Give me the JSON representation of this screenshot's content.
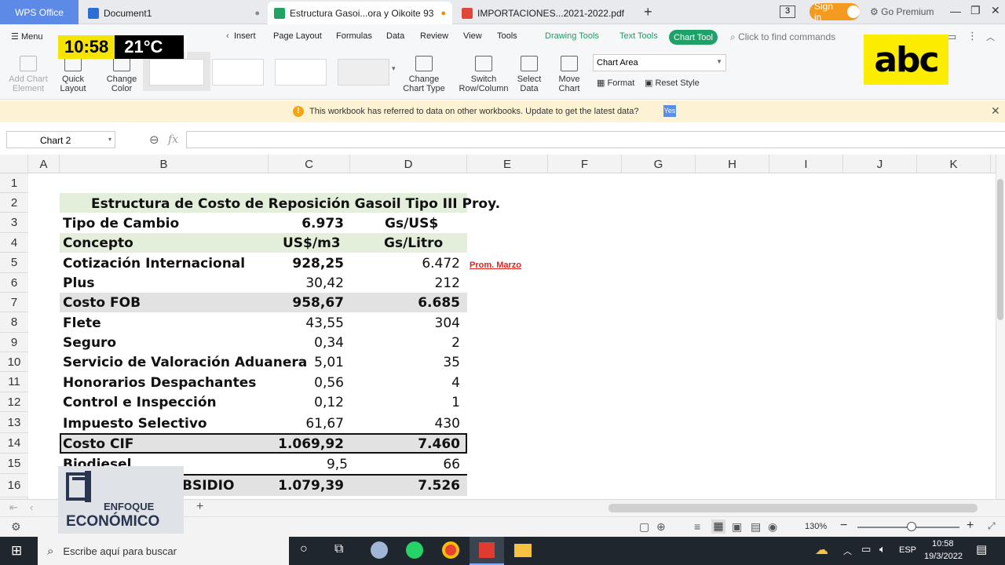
{
  "titlebar": {
    "app_tab": "WPS Office",
    "tabs": [
      {
        "label": "Document1",
        "icon_color": "#2b6fd6"
      },
      {
        "label": "Estructura Gasoi...ora y Oikoite 93",
        "icon_color": "#1ea362"
      },
      {
        "label": "IMPORTACIONES...2021-2022.pdf",
        "icon_color": "#e0463a"
      }
    ],
    "new_tab": "+",
    "page_badge": "3",
    "sign_in": "Sign in",
    "go_premium": "Go Premium"
  },
  "menu": {
    "hamburger": "Menu",
    "items": [
      "Insert",
      "Page Layout",
      "Formulas",
      "Data",
      "Review",
      "View",
      "Tools"
    ],
    "context_items": [
      "Drawing Tools",
      "Text Tools"
    ],
    "active_context": "Chart Tool",
    "search_placeholder": "Click to find commands"
  },
  "ribbon": {
    "add_chart_element": "Add Chart Element",
    "quick_layout": "Quick Layout",
    "change_color": "Change Color",
    "change_chart_type": "Change Chart Type",
    "switch_row_column": "Switch Row/Column",
    "select_data": "Select Data",
    "move_chart": "Move Chart",
    "chart_area_select": "Chart Area",
    "format": "Format",
    "reset_style": "Reset Style"
  },
  "notice": {
    "message": "This workbook has referred to data on other workbooks. Update to get the latest data?",
    "action": "Yes"
  },
  "formula_bar": {
    "name_box": "Chart 2",
    "fx": "fx"
  },
  "columns": [
    "A",
    "B",
    "C",
    "D",
    "E",
    "F",
    "G",
    "H",
    "I",
    "J",
    "K"
  ],
  "rows": [
    "1",
    "2",
    "3",
    "4",
    "5",
    "6",
    "7",
    "8",
    "9",
    "10",
    "11",
    "12",
    "13",
    "14",
    "15",
    "16"
  ],
  "sheet": {
    "title": "Estructura de Costo de Reposición Gasoil Tipo III Proy.",
    "exchange_label": "Tipo de Cambio",
    "exchange_value": "6.973",
    "exchange_unit": "Gs/US$",
    "header_concept": "Concepto",
    "header_usd": "US$/m3",
    "header_gs": "Gs/Litro",
    "note": "Prom. Marzo",
    "lines": [
      {
        "concept": "Cotización Internacional",
        "usd": "928,25",
        "gs": "6.472"
      },
      {
        "concept": "Plus",
        "usd": "30,42",
        "gs": "212"
      },
      {
        "concept": "Costo FOB",
        "usd": "958,67",
        "gs": "6.685"
      },
      {
        "concept": "Flete",
        "usd": "43,55",
        "gs": "304"
      },
      {
        "concept": "Seguro",
        "usd": "0,34",
        "gs": "2"
      },
      {
        "concept": "Servicio de Valoración Aduanera",
        "usd": "5,01",
        "gs": "35"
      },
      {
        "concept": "Honorarios Despachantes",
        "usd": "0,56",
        "gs": "4"
      },
      {
        "concept": "Control e Inspección",
        "usd": "0,12",
        "gs": "1"
      },
      {
        "concept": "Impuesto Selectivo",
        "usd": "61,67",
        "gs": "430"
      },
      {
        "concept": "Costo CIF",
        "usd": "1.069,92",
        "gs": "7.460"
      },
      {
        "concept": "Biodiesel",
        "usd": "9,5",
        "gs": "66"
      },
      {
        "concept": "BSIDIO",
        "usd": "1.079,39",
        "gs": "7.526"
      }
    ]
  },
  "statusbar": {
    "zoom": "130%",
    "minus": "−",
    "plus": "+"
  },
  "overlay": {
    "time": "10:58",
    "temperature": "21°C",
    "brand": "abc",
    "program_top": "ENFOQUE",
    "program_bottom": "ECONÓMICO"
  },
  "taskbar": {
    "search_placeholder": "Escribe aquí para buscar",
    "language": "ESP",
    "time": "10:58",
    "date": "19/3/2022"
  }
}
